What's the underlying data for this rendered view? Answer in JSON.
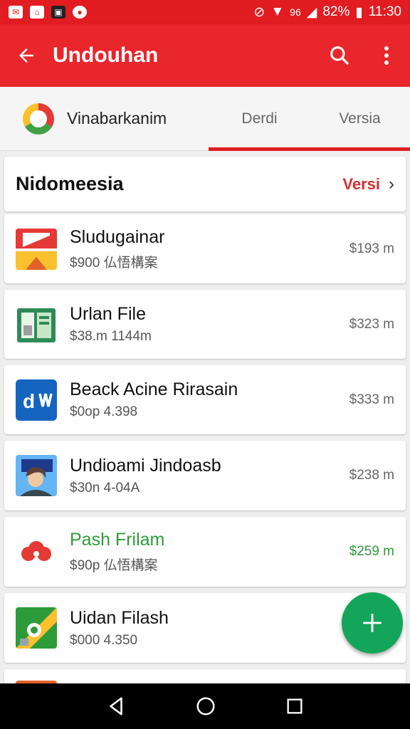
{
  "status": {
    "signal": "96",
    "battery": "82%",
    "time": "11:30"
  },
  "appbar": {
    "title": "Undouhan"
  },
  "tabs": {
    "main": "Vinabarkanim",
    "tab2": "Derdi",
    "tab3": "Versia"
  },
  "section": {
    "title": "Nidomeesia",
    "link": "Versi"
  },
  "items": [
    {
      "name": "Sludugainar",
      "sub": "$900 仏悟構案",
      "size": "$193 m"
    },
    {
      "name": "Urlan File",
      "sub": "$38.m 1144m",
      "size": "$323 m"
    },
    {
      "name": "Beack Acine Rirasain",
      "sub": "$0op 4.398",
      "size": "$333 m"
    },
    {
      "name": "Undioami Jindoasb",
      "sub": "$30n 4-04A",
      "size": "$238 m"
    },
    {
      "name": "Pash Frilam",
      "sub": "$90p 仏悟構案",
      "size": "$259 m"
    },
    {
      "name": "Uidan Filash",
      "sub": "$000 4.350",
      "size": ""
    }
  ],
  "colors": {
    "primary": "#e8262b",
    "accent": "#d32f2f",
    "fab": "#13a65a",
    "green_text": "#2e9b3a"
  }
}
